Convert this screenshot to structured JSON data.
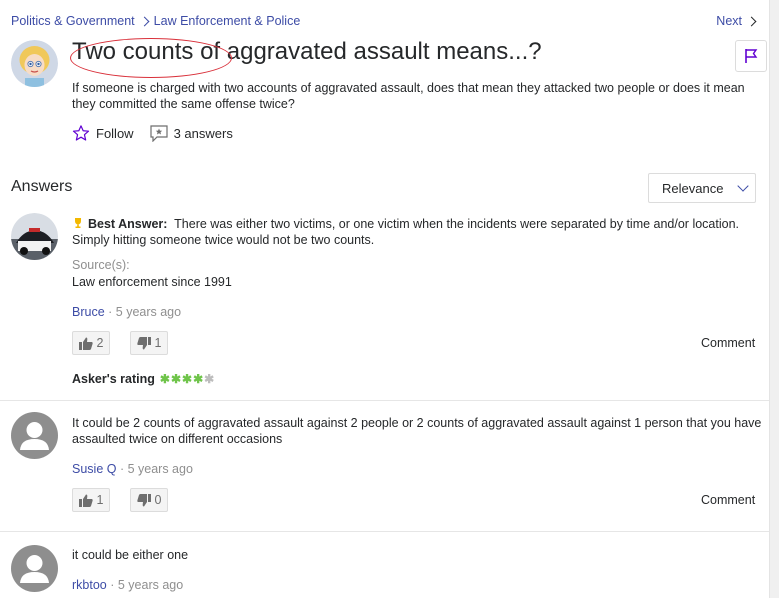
{
  "breadcrumb": {
    "category": "Politics & Government",
    "subcategory": "Law Enforcement & Police"
  },
  "nav": {
    "next": "Next"
  },
  "question": {
    "title": "Two counts of aggravated assault means...?",
    "details": "If someone is charged with two accounts of aggravated assault, does that mean they attacked two people or does it mean they committed the same offense twice?",
    "follow_label": "Follow",
    "answers_count": "3 answers"
  },
  "answers_section": {
    "heading": "Answers",
    "sort_label": "Relevance"
  },
  "answers": [
    {
      "best_label": "Best Answer:",
      "text": "There was either two victims, or one victim when the incidents were separated by time and/or location. Simply hitting someone twice would not be two counts.",
      "source_label": "Source(s):",
      "source": "Law enforcement since 1991",
      "user": "Bruce",
      "time": "5 years ago",
      "thumbs_up": "2",
      "thumbs_down": "1",
      "comment_label": "Comment",
      "rating_label": "Asker's rating",
      "rating": 4,
      "rating_max": 5
    },
    {
      "text": "It could be 2 counts of aggravated assault against 2 people or 2 counts of aggravated assault against 1 person that you have assaulted twice on different occasions",
      "user": "Susie Q",
      "time": "5 years ago",
      "thumbs_up": "1",
      "thumbs_down": "0",
      "comment_label": "Comment"
    },
    {
      "text": "it could be either one",
      "user": "rkbtoo",
      "time": "5 years ago"
    }
  ],
  "colors": {
    "link": "#3d4ca6",
    "accent_purple": "#6001d2",
    "star_green": "#6fc44a",
    "annotation_red": "#d9303a"
  },
  "icons": [
    "flag-icon",
    "star-outline-icon",
    "answers-icon",
    "chevron-down-icon",
    "chevron-right-icon",
    "thumbs-up-icon",
    "thumbs-down-icon",
    "trophy-icon"
  ]
}
